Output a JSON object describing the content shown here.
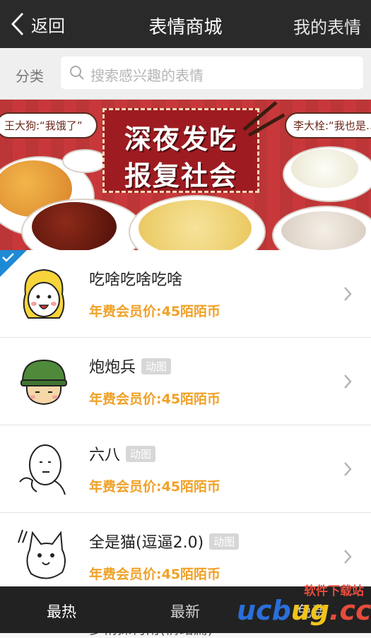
{
  "nav": {
    "back_label": "返回",
    "title": "表情商城",
    "right_label": "我的表情"
  },
  "search": {
    "category_label": "分类",
    "placeholder": "搜索感兴趣的表情"
  },
  "banner": {
    "title_line1": "深夜发吃",
    "title_line2": "报复社会",
    "bubble_left": "王大狗:“我饿了”",
    "bubble_right": "李大栓:“我也是…”"
  },
  "items": [
    {
      "name": "吃啥吃啥吃啥",
      "badge": "",
      "price": "年费会员价:45陌陌币",
      "selected": true
    },
    {
      "name": "炮炮兵",
      "badge": "动图",
      "price": "年费会员价:45陌陌币"
    },
    {
      "name": "六八",
      "badge": "动图",
      "price": "年费会员价:45陌陌币"
    },
    {
      "name": "全是猫(逗逼2.0)",
      "badge": "动图",
      "price": "年费会员价:45陌陌币"
    }
  ],
  "peek_item": "多侑探柯南(情绪篇)",
  "tabs": [
    "最热",
    "最新",
    "免费"
  ],
  "watermark": {
    "top": "软件下载站",
    "logo": "ucbug.cc"
  },
  "colors": {
    "nav_bg": "#2a2a2a",
    "price": "#f0a127",
    "banner": "#c8383a",
    "selected": "#1e8ad6"
  }
}
